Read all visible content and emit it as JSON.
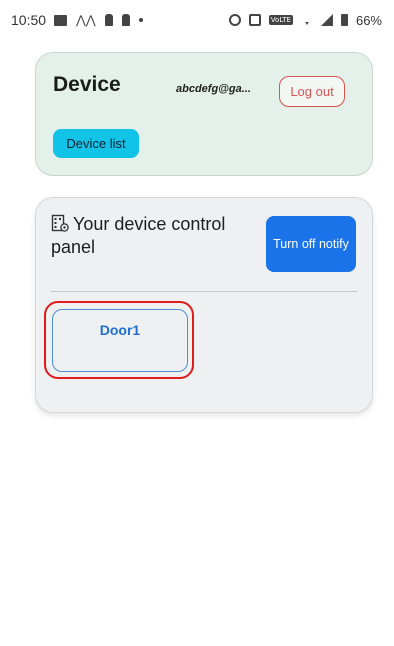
{
  "status_bar": {
    "time": "10:50",
    "battery": "66%"
  },
  "header": {
    "title": "Device",
    "user_email": "abcdefg@ga...",
    "logout_label": "Log out",
    "device_list_label": "Device list"
  },
  "panel": {
    "title": "Your device control panel",
    "icon": "building-gear-icon",
    "notify_label": "Turn off notify",
    "devices": [
      {
        "label": "Door1"
      }
    ]
  },
  "colors": {
    "header_bg": "#e4f0ea",
    "panel_bg": "#eef0f2",
    "accent_blue": "#1a73e8",
    "cyan_button": "#12c3e8",
    "logout_red": "#d9534f",
    "highlight_red": "#e01b1b"
  }
}
